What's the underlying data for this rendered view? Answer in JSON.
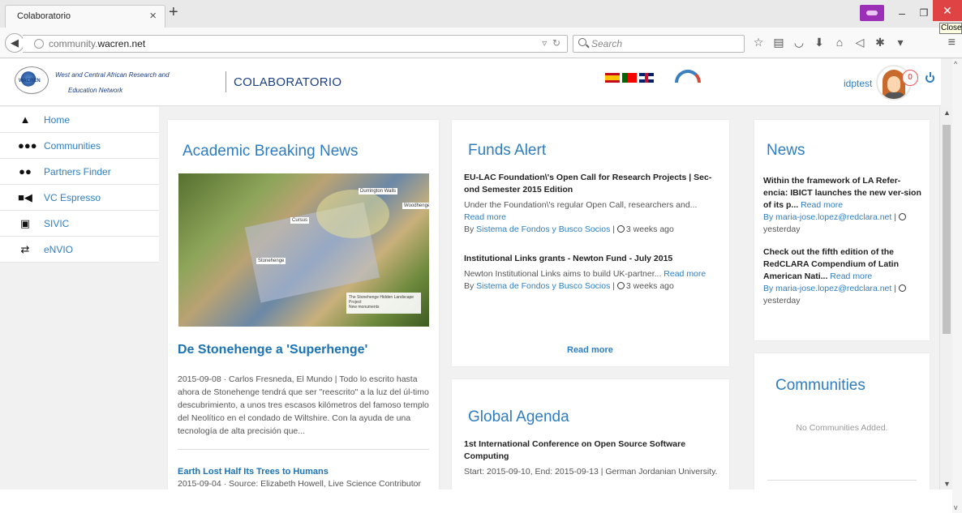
{
  "browser": {
    "tab_title": "Colaboratorio",
    "url_prefix": "community.",
    "url_domain": "wacren.net",
    "search_placeholder": "Search",
    "close_tooltip": "Close",
    "icons": [
      "star-icon",
      "reading-list-icon",
      "pocket-icon",
      "download-icon",
      "home-icon",
      "send-icon",
      "extension-icon",
      "menu-icon"
    ]
  },
  "header": {
    "logo_line1": "West and Central African Research and",
    "logo_line2": "Education Network",
    "logo_mark": "WACREN",
    "title": "COLABORATORIO",
    "username": "idptest",
    "notifications": "0"
  },
  "sidebar": {
    "items": [
      {
        "label": "Home",
        "icon": "home-icon"
      },
      {
        "label": "Communities",
        "icon": "communities-icon"
      },
      {
        "label": "Partners Finder",
        "icon": "partners-icon"
      },
      {
        "label": "VC Espresso",
        "icon": "video-camera-icon"
      },
      {
        "label": "SIVIC",
        "icon": "sivic-icon"
      },
      {
        "label": "eNVIO",
        "icon": "exchange-icon"
      }
    ]
  },
  "academic": {
    "heading": "Academic Breaking News",
    "image_labels": [
      "Durrington Walls",
      "Cursus",
      "Stonehenge",
      "Woodhenge",
      "The Stonehenge Hidden Landscape Project",
      "New monuments"
    ],
    "article_title": "De Stonehenge a 'Superhenge'",
    "article_date": "2015-09-08",
    "article_body": "· Carlos Fresneda, El Mundo | Todo lo escrito hasta ahora de Stonehenge tendrá que ser \"reescrito\" a la luz del úl-timo descubrimiento, a unos tres escasos kilómetros del famoso templo del Neolítico en el condado de Wiltshire. Con la ayuda de una tecnología de alta precisión que...",
    "article2_title": "Earth Lost Half Its Trees to Humans",
    "article2_date": "2015-09-04",
    "article2_meta": " · Source: Elizabeth Howell, Live Science Contributor"
  },
  "funds": {
    "heading": "Funds Alert",
    "items": [
      {
        "title": "EU-LAC Foundation\\'s Open Call for Research Projects | Sec-ond Semester 2015 Edition",
        "excerpt": "Under the Foundation\\'s regular Open Call, researchers and...",
        "read_more": "Read more",
        "by": "By ",
        "author": "Sistema de Fondos y Busco Socios",
        "when": "3 weeks ago"
      },
      {
        "title": "Institutional Links grants - Newton Fund - July 2015",
        "excerpt": "Newton Institutional Links aims to build UK-partner...",
        "read_more": "Read more",
        "by": "By ",
        "author": "Sistema de Fondos y Busco Socios",
        "when": "3 weeks ago"
      }
    ],
    "read_more_all": "Read more"
  },
  "agenda": {
    "heading": "Global Agenda",
    "item_title": "1st International Conference on Open Source Software Computing",
    "item_meta": "Start: 2015-09-10, End: 2015-09-13 | German Jordanian University."
  },
  "news": {
    "heading": "News",
    "items": [
      {
        "title": "Within the framework of LA Refer-encia: IBICT launches the new ver-sion of its p...",
        "read_more": "Read more",
        "author": "By maria-jose.lopez@redclara.net",
        "when": "yesterday"
      },
      {
        "title": "Check out the fifth edition of the RedCLARA Compendium of Latin American Nati...",
        "read_more": "Read more",
        "author": "By maria-jose.lopez@redclara.net",
        "when": "yesterday"
      }
    ]
  },
  "communities": {
    "heading": "Communities",
    "empty": "No Communities Added."
  },
  "colors": {
    "accent": "#2f7dbf",
    "title_blue": "#1b3f83",
    "link_blue": "#1b73b5",
    "close_red": "#e04343",
    "private_purple": "#9b2fb5"
  }
}
